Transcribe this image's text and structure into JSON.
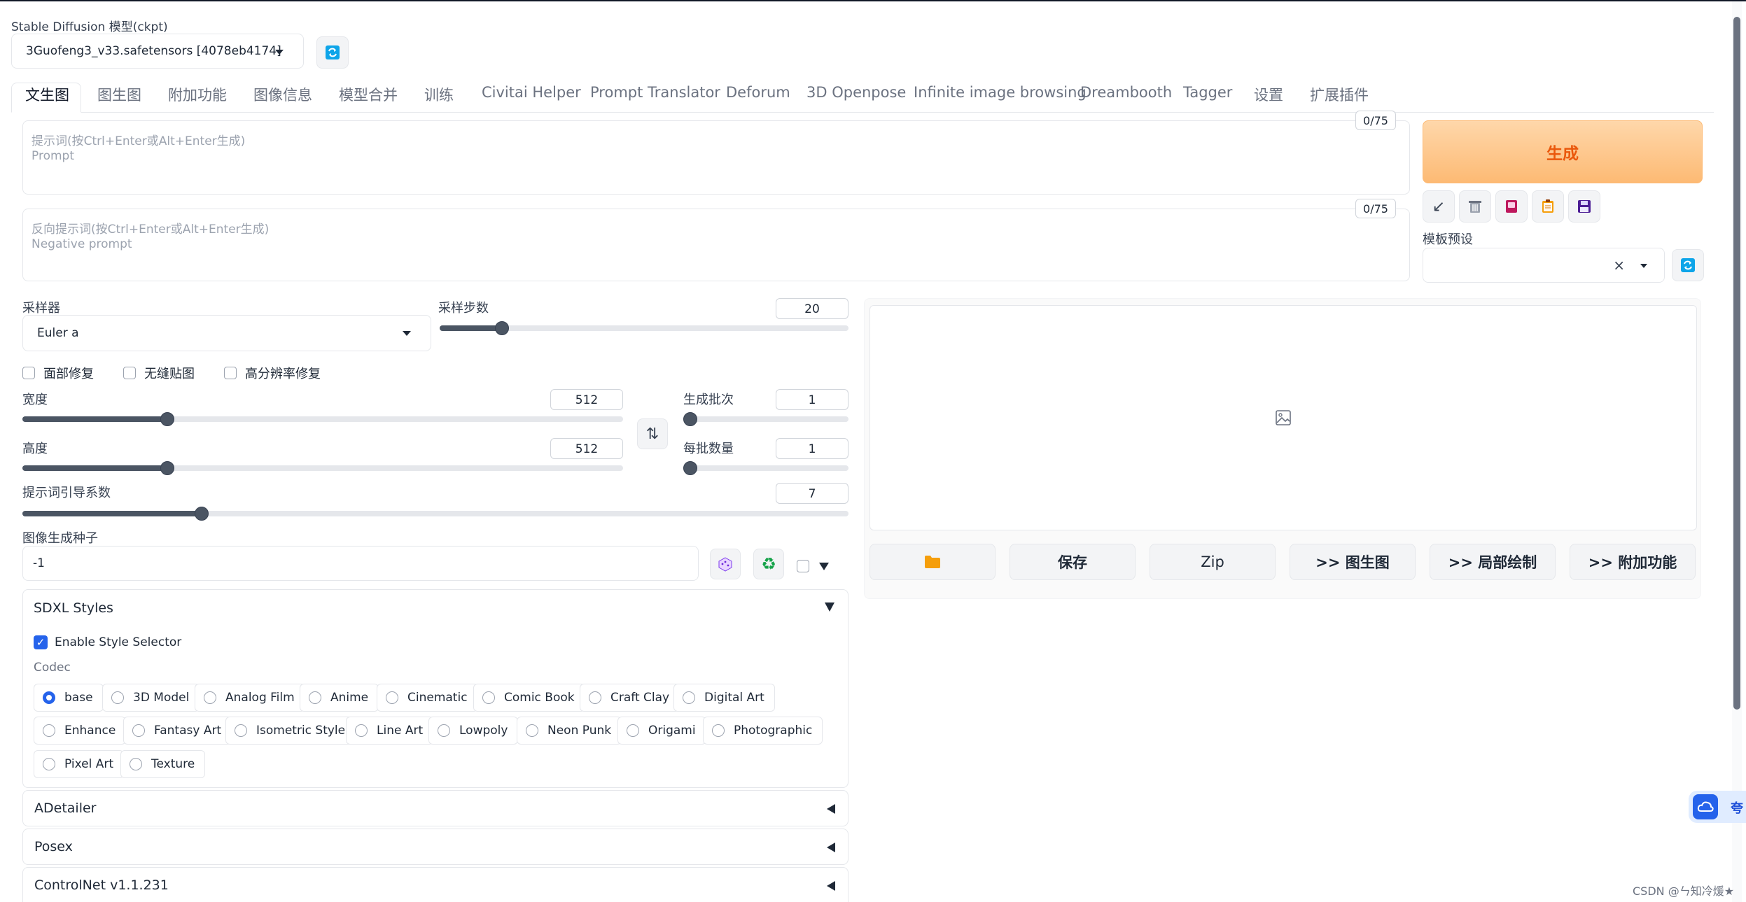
{
  "model": {
    "label": "Stable Diffusion 模型(ckpt)",
    "selected": "3Guofeng3_v33.safetensors [4078eb4174]"
  },
  "tabs": [
    "文生图",
    "图生图",
    "附加功能",
    "图像信息",
    "模型合并",
    "训练",
    "Civitai Helper",
    "Prompt Translator",
    "Deforum",
    "3D Openpose",
    "Infinite image browsing",
    "Dreambooth",
    "Tagger",
    "设置",
    "扩展插件"
  ],
  "prompt": {
    "placeholder_line1": "提示词(按Ctrl+Enter或Alt+Enter生成)",
    "placeholder_line2": "Prompt",
    "token_count": "0/75"
  },
  "negative_prompt": {
    "placeholder_line1": "反向提示词(按Ctrl+Enter或Alt+Enter生成)",
    "placeholder_line2": "Negative prompt",
    "token_count": "0/75"
  },
  "generate_label": "生成",
  "preset": {
    "label": "模板预设",
    "clear": "×"
  },
  "sampler": {
    "label": "采样器",
    "value": "Euler a"
  },
  "steps": {
    "label": "采样步数",
    "value": "20",
    "fraction": 0.14
  },
  "options": {
    "face_restore": "面部修复",
    "tiling": "无缝贴图",
    "hires_fix": "高分辨率修复"
  },
  "width": {
    "label": "宽度",
    "value": "512",
    "fraction": 0.235
  },
  "height": {
    "label": "高度",
    "value": "512",
    "fraction": 0.235
  },
  "batch_count": {
    "label": "生成批次",
    "value": "1",
    "fraction": 0.0
  },
  "batch_size": {
    "label": "每批数量",
    "value": "1",
    "fraction": 0.0
  },
  "cfg": {
    "label": "提示词引导系数",
    "value": "7",
    "fraction": 0.212
  },
  "seed": {
    "label": "图像生成种子",
    "value": "-1"
  },
  "sdxl": {
    "title": "SDXL Styles",
    "enable_label": "Enable Style Selector",
    "codec_label": "Codec",
    "styles": [
      "base",
      "3D Model",
      "Analog Film",
      "Anime",
      "Cinematic",
      "Comic Book",
      "Craft Clay",
      "Digital Art",
      "Enhance",
      "Fantasy Art",
      "Isometric Style",
      "Line Art",
      "Lowpoly",
      "Neon Punk",
      "Origami",
      "Photographic",
      "Pixel Art",
      "Texture"
    ],
    "selected": "base"
  },
  "accordions": [
    "ADetailer",
    "Posex",
    "ControlNet v1.1.231"
  ],
  "output_buttons": {
    "save": "保存",
    "zip": "Zip",
    "to_img2img": ">> 图生图",
    "to_inpaint": ">> 局部绘制",
    "to_extras": ">> 附加功能"
  },
  "watermark": "CSDN @ㄣ知冷煖★",
  "floating_badge": "夸"
}
